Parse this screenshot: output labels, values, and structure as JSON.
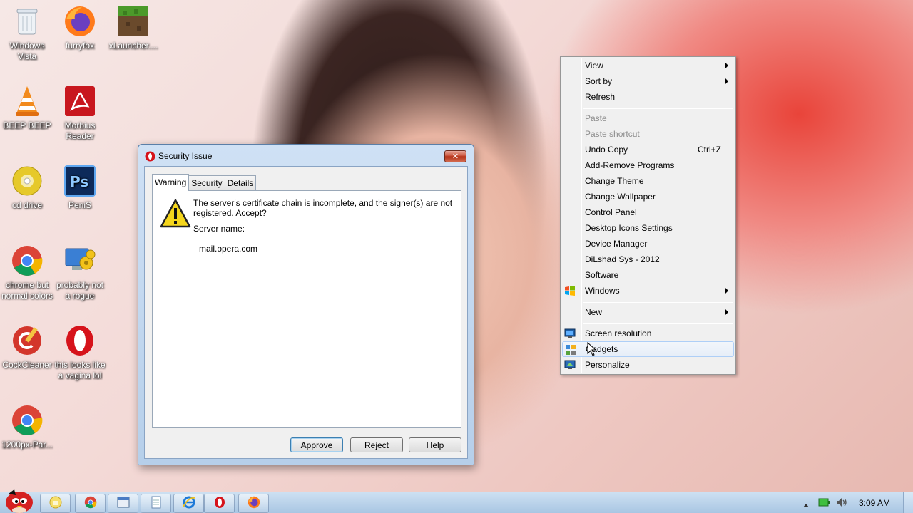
{
  "desktop": {
    "icons": [
      {
        "label": "Windows Vista",
        "icon": "recycle-bin-icon"
      },
      {
        "label": "furryfox",
        "icon": "firefox-icon"
      },
      {
        "label": "xLauncher....",
        "icon": "minecraft-icon"
      },
      {
        "label": "BEEP BEEP",
        "icon": "vlc-icon"
      },
      {
        "label": "Morbius Reader",
        "icon": "pdf-reader-icon"
      },
      {
        "label": "cd drive",
        "icon": "cd-drive-icon"
      },
      {
        "label": "PeniS",
        "icon": "photoshop-icon"
      },
      {
        "label": "chrome but normal colors",
        "icon": "chrome-icon"
      },
      {
        "label": "probably not a rogue",
        "icon": "computer-gears-icon"
      },
      {
        "label": "CockCleaner",
        "icon": "ccleaner-icon"
      },
      {
        "label": "this looks like a vagina lol",
        "icon": "opera-icon"
      },
      {
        "label": "1200px-Par...",
        "icon": "chrome-icon"
      }
    ]
  },
  "dialog": {
    "title": "Security Issue",
    "close_symbol": "✕",
    "tabs": [
      {
        "label": "Warning"
      },
      {
        "label": "Security"
      },
      {
        "label": "Details"
      }
    ],
    "message": "The server's certificate chain is incomplete, and the signer(s) are not registered. Accept?",
    "server_label": "Server name:",
    "server_value": "mail.opera.com",
    "buttons": {
      "approve": "Approve",
      "reject": "Reject",
      "help": "Help"
    }
  },
  "context_menu": {
    "items": [
      {
        "label": "View",
        "submenu": true
      },
      {
        "label": "Sort by",
        "submenu": true
      },
      {
        "label": "Refresh"
      },
      {
        "label": "Paste",
        "disabled": true
      },
      {
        "label": "Paste shortcut",
        "disabled": true
      },
      {
        "label": "Undo Copy",
        "shortcut": "Ctrl+Z"
      },
      {
        "label": "Add-Remove Programs"
      },
      {
        "label": "Change Theme"
      },
      {
        "label": "Change Wallpaper"
      },
      {
        "label": "Control Panel"
      },
      {
        "label": "Desktop Icons Settings"
      },
      {
        "label": "Device Manager"
      },
      {
        "label": "DiLshad Sys - 2012"
      },
      {
        "label": "Software"
      },
      {
        "label": "Windows",
        "submenu": true,
        "icon": "windows-logo-icon"
      },
      {
        "label": "New",
        "submenu": true
      },
      {
        "label": "Screen resolution",
        "icon": "monitor-icon"
      },
      {
        "label": "Gadgets",
        "icon": "gadgets-icon",
        "highlighted": true
      },
      {
        "label": "Personalize",
        "icon": "personalize-icon"
      }
    ]
  },
  "taskbar": {
    "items": [
      {
        "icon": "explorer-folder-icon"
      },
      {
        "icon": "chrome-icon"
      },
      {
        "icon": "window-icon"
      },
      {
        "icon": "notepad-icon"
      },
      {
        "icon": "internet-explorer-icon"
      },
      {
        "icon": "opera-icon"
      },
      {
        "icon": "firefox-icon"
      }
    ],
    "clock": "3:09 AM"
  },
  "colors": {
    "menu_highlight": "#e6eef8",
    "taskbar": "#b8d0ea",
    "close_button": "#c4482f"
  }
}
